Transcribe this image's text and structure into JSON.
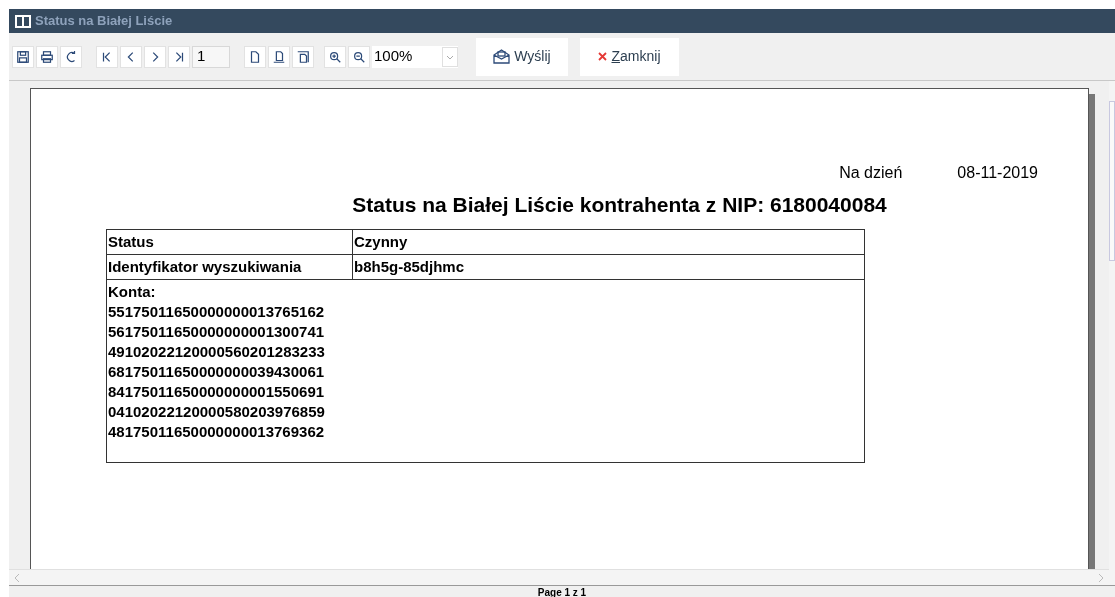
{
  "window": {
    "title": "Status na Białej Liście"
  },
  "toolbar": {
    "page_number": "1",
    "zoom": "100%",
    "send_button": "Wyślij",
    "close_button": "Zamknij"
  },
  "report": {
    "date_label": "Na dzień",
    "date": "08-11-2019",
    "title": "Status na Białej Liście kontrahenta z NIP: 6180040084",
    "rows": [
      {
        "label": "Status",
        "value": "Czynny"
      },
      {
        "label": "Identyfikator wyszukiwania",
        "value": "b8h5g-85djhmc"
      }
    ],
    "accounts_label": "Konta:",
    "accounts": [
      "55175011650000000013765162",
      "56175011650000000001300741",
      "49102022120000560201283233",
      "68175011650000000039430061",
      "84175011650000000001550691",
      "04102022120000580203976859",
      "48175011650000000013769362"
    ]
  },
  "status_bar": {
    "page": "Page 1 z 1"
  }
}
